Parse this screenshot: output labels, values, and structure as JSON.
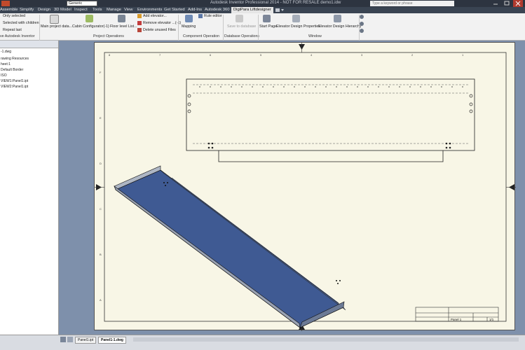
{
  "app": {
    "appearance": "Generic",
    "title": "Autodesk Inventor Professional 2014 - NOT FOR RESALE   demo1.idw",
    "search_placeholder": "Type a keyword or phrase"
  },
  "tabs": [
    "Assemble",
    "Simplify",
    "Design",
    "3D Model",
    "Inspect",
    "Tools",
    "Manage",
    "View",
    "Environments",
    "Get Started",
    "Add-Ins",
    "Autodesk 360",
    "DigiPara Liftdesigner"
  ],
  "active_tab": "DigiPara Liftdesigner",
  "ribbon": {
    "select": {
      "only_selected": "Only selected",
      "selected_with_children": "Selected with children",
      "repeat_last": "Repeat last"
    },
    "project_ops": {
      "main_project_data": "Main project data...",
      "cabin_configurator": "Cabin Configurator(-1)",
      "floor_level_list": "Floor level List...",
      "add_elevator": "Add elevator...",
      "remove_elevator": "Remove elevator ...(-1)",
      "delete_unused": "Delete unused Files",
      "label": "Project Operations"
    },
    "component_ops": {
      "mapping": "Mapping",
      "rule_editor": "Rule editor",
      "label": "Component Operation"
    },
    "database_ops": {
      "save_to_database": "Save to database",
      "label": "Database Operations"
    },
    "window": {
      "start_page": "Start Page",
      "design_properties": "Elevator Design Properties",
      "design_hierarchy": "Elevator Design Hierarchy",
      "label": "Window"
    },
    "autodesk_inventor": "ve Autodesk Inventor"
  },
  "browser": {
    "items": [
      "-1.dwg",
      "rawing Resources",
      "heet:1",
      "Default Border",
      "ISO",
      "VIEW1:Panel1.ipt",
      "VIEW2:Panel1.ipt"
    ]
  },
  "doc_tabs": [
    "Panel1.ipt",
    "Panel1-1.dwg"
  ],
  "active_doc_tab": "Panel1-1.dwg",
  "title_block": {
    "sheet": "Panel 1",
    "page": "1/1"
  },
  "border_numbers": {
    "top": [
      "8",
      "7",
      "6",
      "5",
      "4",
      "3",
      "2",
      "1"
    ],
    "side": [
      "F",
      "E",
      "D",
      "C",
      "B",
      "A"
    ]
  },
  "colors": {
    "sheet": "#f8f6e6",
    "canvas": "#7e90ab",
    "panel_face": "#3f5a93",
    "active_tab": "#e6e6e6"
  }
}
